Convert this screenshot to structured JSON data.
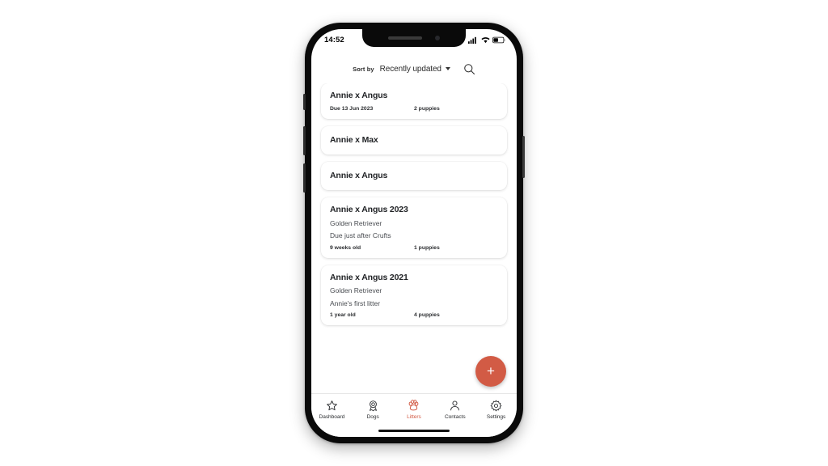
{
  "status_bar": {
    "time": "14:52",
    "icons": [
      "signal-bars-icon",
      "wifi-icon",
      "battery-icon"
    ]
  },
  "toolbar": {
    "sort_by_label": "Sort by",
    "sort_value": "Recently updated",
    "caret_icon": "chevron-down-icon",
    "search_icon": "search-icon"
  },
  "litters": [
    {
      "title": "Annie x Angus",
      "breed": "",
      "note": "",
      "age": "Due 13 Jun 2023",
      "count": "2 puppies"
    },
    {
      "title": "Annie x Max",
      "breed": "",
      "note": "",
      "age": "",
      "count": ""
    },
    {
      "title": "Annie x Angus",
      "breed": "",
      "note": "",
      "age": "",
      "count": ""
    },
    {
      "title": "Annie x Angus 2023",
      "breed": "Golden Retriever",
      "note": "Due just after Crufts",
      "age": "9 weeks old",
      "count": "1 puppies"
    },
    {
      "title": "Annie x Angus 2021",
      "breed": "Golden Retriever",
      "note": "Annie's first litter",
      "age": "1 year old",
      "count": "4 puppies"
    }
  ],
  "fab": {
    "icon": "plus-icon",
    "label": "+",
    "color": "#d25b45"
  },
  "bottom_nav": {
    "active_color": "#d25b45",
    "items": [
      {
        "label": "Dashboard",
        "icon": "star-icon",
        "active": false
      },
      {
        "label": "Dogs",
        "icon": "rosette-icon",
        "active": false
      },
      {
        "label": "Litters",
        "icon": "paw-icon",
        "active": true
      },
      {
        "label": "Contacts",
        "icon": "person-icon",
        "active": false
      },
      {
        "label": "Settings",
        "icon": "gear-icon",
        "active": false
      }
    ]
  }
}
